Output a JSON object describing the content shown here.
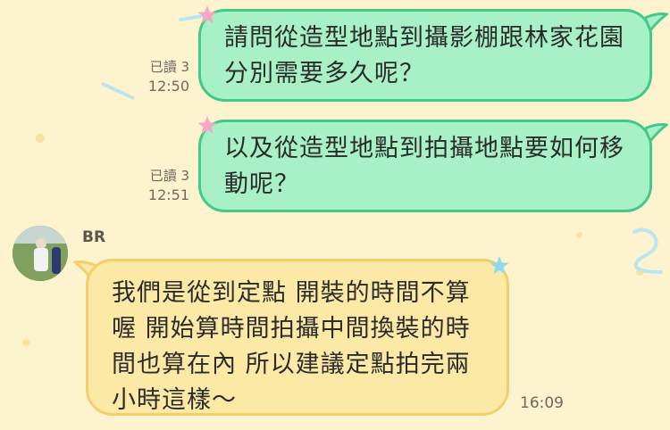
{
  "messages": [
    {
      "direction": "outgoing",
      "text": "請問從造型地點到攝影棚跟林家花園分別需要多久呢？",
      "read_status": "已讀 3",
      "time": "12:50"
    },
    {
      "direction": "outgoing",
      "text": "以及從造型地點到拍攝地點要如何移動呢？",
      "read_status": "已讀 3",
      "time": "12:51"
    },
    {
      "direction": "incoming",
      "sender": "BR",
      "text": "我們是從到定點 開裝的時間不算喔 開始算時間拍攝中間換裝的時間也算在內 所以建議定點拍完兩小時這樣～",
      "time": "16:09"
    }
  ],
  "colors": {
    "background": "#fdf3cf",
    "outgoing_bubble": "#a8f0c6",
    "outgoing_border": "#43c98a",
    "incoming_bubble": "#fde9a6",
    "incoming_border": "#f2cf6a"
  },
  "icons": [
    "star-icon",
    "avatar"
  ]
}
